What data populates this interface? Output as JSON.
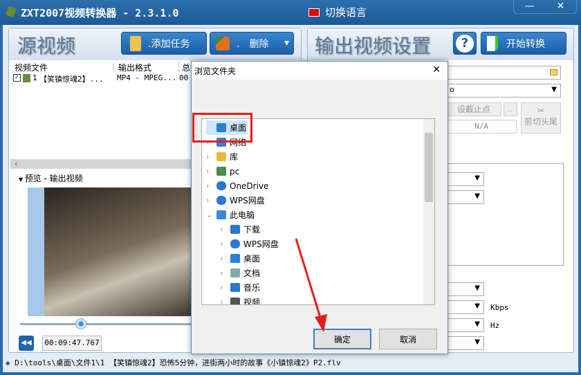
{
  "app": {
    "title": "ZXT2007视频转换器 - 2.3.1.0",
    "language_button": "切换语言",
    "minimize": "—",
    "close": "✕"
  },
  "left": {
    "heading": "源视频",
    "add_task": ".添加任务",
    "delete": ".　删除",
    "columns": [
      "视频文件",
      "输出格式",
      "总时"
    ],
    "rows": [
      {
        "index": "1",
        "name": "【笑镇惊魂2】...",
        "format": "MP4 - MPEG...",
        "duration": "00"
      }
    ],
    "preview_label": "预览 - 输出视频",
    "time": "00:09:47.767"
  },
  "right": {
    "heading": "输出视频设置",
    "start": "开始转换",
    "help": "?",
    "combo_value": "o",
    "set_end": "设截止点",
    "more": "..",
    "na": "N/A",
    "cut": "剪切头尾",
    "units": [
      "Kbps",
      "Hz"
    ]
  },
  "dialog": {
    "title": "浏览文件夹",
    "close": "✕",
    "ok": "确定",
    "cancel": "取消",
    "tree": [
      {
        "label": "桌面",
        "level": 0,
        "chev": "",
        "icon": "desktop"
      },
      {
        "label": "网络",
        "level": 0,
        "chev": "›",
        "icon": "network"
      },
      {
        "label": "库",
        "level": 0,
        "chev": "›",
        "icon": "library"
      },
      {
        "label": "pc",
        "level": 0,
        "chev": "›",
        "icon": "user"
      },
      {
        "label": "OneDrive",
        "level": 0,
        "chev": "›",
        "icon": "cloud"
      },
      {
        "label": "WPS网盘",
        "level": 0,
        "chev": "›",
        "icon": "cloud"
      },
      {
        "label": "此电脑",
        "level": 0,
        "chev": "⌄",
        "icon": "computer"
      },
      {
        "label": "下载",
        "level": 1,
        "chev": "›",
        "icon": "download"
      },
      {
        "label": "WPS网盘",
        "level": 1,
        "chev": "›",
        "icon": "cloud"
      },
      {
        "label": "桌面",
        "level": 1,
        "chev": "›",
        "icon": "desktop"
      },
      {
        "label": "文档",
        "level": 1,
        "chev": "›",
        "icon": "document"
      },
      {
        "label": "音乐",
        "level": 1,
        "chev": "›",
        "icon": "music"
      },
      {
        "label": "视频",
        "level": 1,
        "chev": "›",
        "icon": "video"
      }
    ]
  },
  "status": "D:\\tools\\桌面\\文件1\\1 【笑镇惊魂2】恐怖5分钟，进街两小时的故事《小镇惊魂2》P2.flv",
  "colors": {
    "accent": "#1f5fa0",
    "highlight": "#e02020"
  }
}
